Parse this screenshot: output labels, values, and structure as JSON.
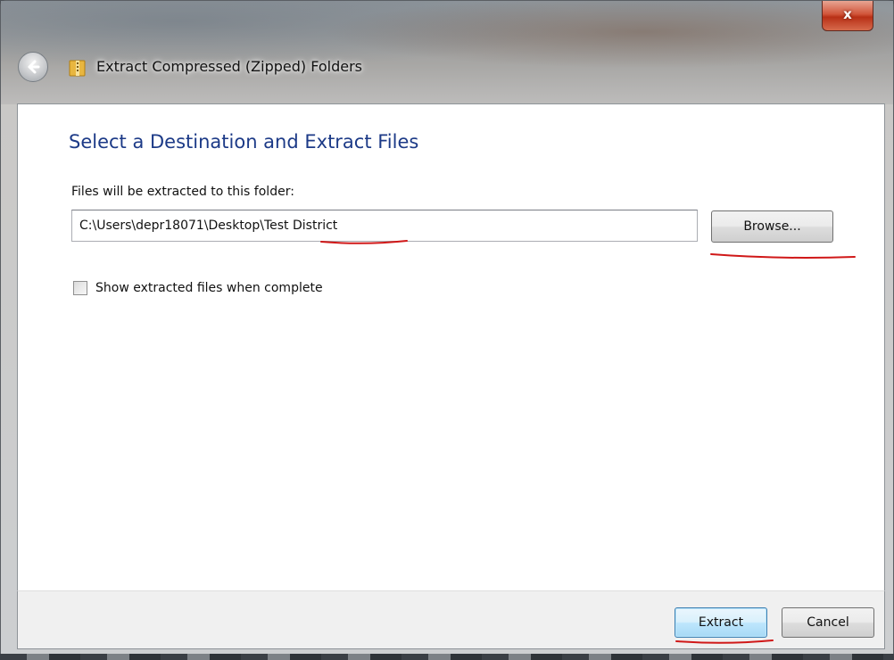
{
  "window": {
    "title": "Extract Compressed (Zipped) Folders",
    "close_glyph": "x",
    "back_icon": "back-arrow-icon",
    "folder_icon": "zipped-folder-icon"
  },
  "main": {
    "heading": "Select a Destination and Extract Files",
    "prompt": "Files will be extracted to this folder:",
    "path_value": "C:\\Users\\depr18071\\Desktop\\Test District",
    "browse_label": "Browse...",
    "show_files_label": "Show extracted files when complete",
    "show_files_checked": false
  },
  "footer": {
    "extract_label": "Extract",
    "cancel_label": "Cancel"
  },
  "colors": {
    "heading": "#1c3a87",
    "annotation": "#d01818",
    "default_button": "#a7d9f5"
  }
}
